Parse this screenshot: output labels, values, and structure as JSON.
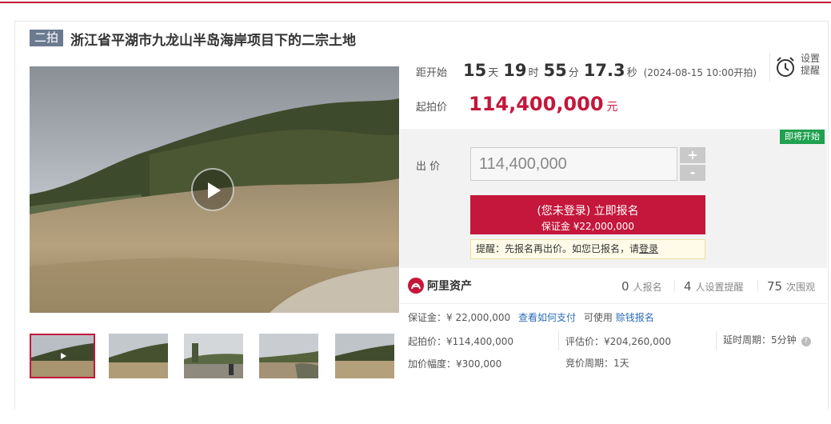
{
  "header": {
    "round_badge": "二拍",
    "title": "浙江省平湖市九龙山半岛海岸项目下的二宗土地"
  },
  "countdown": {
    "label": "距开始",
    "days": "15",
    "days_unit": "天",
    "hours": "19",
    "hours_unit": "时",
    "minutes": "55",
    "minutes_unit": "分",
    "seconds": "17.3",
    "seconds_unit": "秒",
    "start_time": "(2024-08-15 10:00开拍)"
  },
  "reminder": {
    "label_line1": "设置",
    "label_line2": "提醒",
    "icon": "alarm-clock-icon"
  },
  "start_price": {
    "label": "起拍价",
    "value": "114,400,000",
    "unit": "元"
  },
  "bid": {
    "status_badge": "即将开始",
    "label": "出 价",
    "input_value": "114,400,000",
    "plus": "+",
    "minus": "-",
    "signup_line1": "(您未登录) 立即报名",
    "signup_line2": "保证金 ¥22,000,000",
    "tip_prefix": "提醒：先报名再出价。如您已报名，请",
    "tip_login": "登录"
  },
  "platform": {
    "name": "阿里资产"
  },
  "stats": [
    {
      "count": "0",
      "label": "人报名"
    },
    {
      "count": "4",
      "label": "人设置提醒"
    },
    {
      "count": "75",
      "label": "次围观"
    }
  ],
  "deposit": {
    "text": "保证金：¥ 22,000,000",
    "pay_link": "查看如何支付",
    "available": "可使用",
    "credit_link": "赊钱报名"
  },
  "details": {
    "start_price": "起拍价：¥114,400,000",
    "increment": "加价幅度：¥300,000",
    "appraisal": "评估价：¥204,260,000",
    "bid_period": "竞价周期：1天",
    "extension": "延时周期：5分钟"
  },
  "colors": {
    "brand_red": "#c4173b",
    "badge_green": "#1fa150",
    "link_blue": "#2d6db5"
  }
}
